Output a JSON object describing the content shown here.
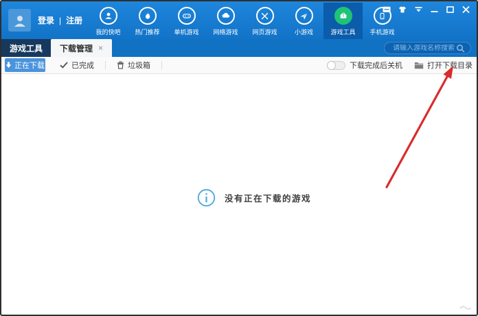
{
  "account": {
    "login": "登录",
    "separator": "|",
    "register": "注册"
  },
  "nav": {
    "items": [
      {
        "label": "我的快吧",
        "icon": "user-icon",
        "selected": false
      },
      {
        "label": "热门推荐",
        "icon": "flame-icon",
        "selected": false
      },
      {
        "label": "单机游戏",
        "icon": "gamepad-icon",
        "selected": false
      },
      {
        "label": "网络游戏",
        "icon": "cloud-icon",
        "selected": false
      },
      {
        "label": "网页游戏",
        "icon": "crossed-swords-icon",
        "selected": false
      },
      {
        "label": "小游戏",
        "icon": "paper-plane-icon",
        "selected": false
      },
      {
        "label": "游戏工具",
        "icon": "toolbox-icon",
        "selected": true
      },
      {
        "label": "手机游戏",
        "icon": "phone-icon",
        "selected": false
      }
    ]
  },
  "window_controls": [
    "message-icon",
    "skin-icon",
    "menu-down-icon",
    "minimize-icon",
    "maximize-icon",
    "close-icon"
  ],
  "tabs": {
    "inactive": "游戏工具",
    "active": "下载管理",
    "close_glyph": "×"
  },
  "search": {
    "placeholder": "请输入游戏名称搜索"
  },
  "toolbar": {
    "downloading": "正在下载",
    "completed": "已完成",
    "trash": "垃圾箱",
    "shutdown_toggle": "下载完成后关机",
    "toggle_state": "off",
    "open_dir": "打开下载目录"
  },
  "content": {
    "empty_message": "没有正在下载的游戏"
  },
  "colors": {
    "topbar_blue": "#1273c7",
    "selected_nav_bg": "#0b5cab",
    "tool_green": "#1fc377",
    "dark_tab": "#17395e",
    "primary_button": "#4a94dc",
    "info_blue": "#56abdc",
    "annotation_red": "#d92c2c"
  }
}
